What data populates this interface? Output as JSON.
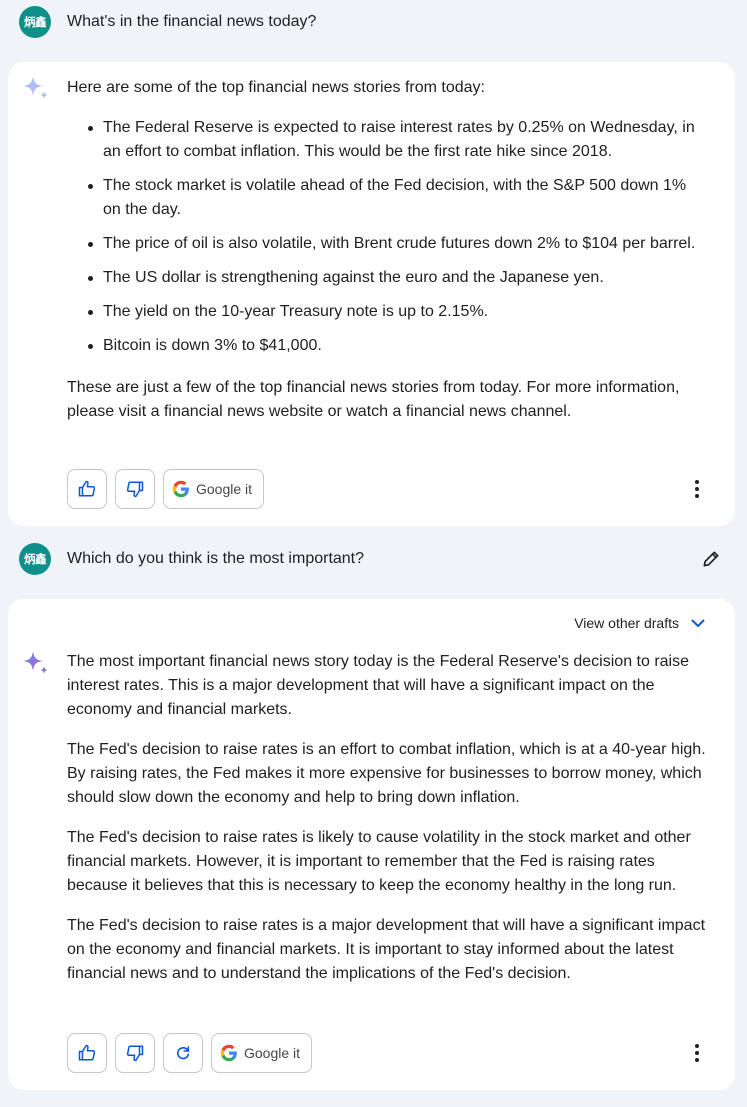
{
  "conversation": {
    "user_initials": "炳鑫",
    "turns": [
      {
        "prompt": "What's in the financial news today?",
        "response": {
          "intro": "Here are some of the top financial news stories from today:",
          "bullets": [
            "The Federal Reserve is expected to raise interest rates by 0.25% on Wednesday, in an effort to combat inflation. This would be the first rate hike since 2018.",
            "The stock market is volatile ahead of the Fed decision, with the S&P 500 down 1% on the day.",
            "The price of oil is also volatile, with Brent crude futures down 2% to $104 per barrel.",
            "The US dollar is strengthening against the euro and the Japanese yen.",
            "The yield on the 10-year Treasury note is up to 2.15%.",
            "Bitcoin is down 3% to $41,000."
          ],
          "outro": "These are just a few of the top financial news stories from today. For more information, please visit a financial news website or watch a financial news channel."
        }
      },
      {
        "prompt": "Which do you think is the most important?",
        "response": {
          "paragraphs": [
            "The most important financial news story today is the Federal Reserve's decision to raise interest rates. This is a major development that will have a significant impact on the economy and financial markets.",
            "The Fed's decision to raise rates is an effort to combat inflation, which is at a 40-year high. By raising rates, the Fed makes it more expensive for businesses to borrow money, which should slow down the economy and help to bring down inflation.",
            "The Fed's decision to raise rates is likely to cause volatility in the stock market and other financial markets. However, it is important to remember that the Fed is raising rates because it believes that this is necessary to keep the economy healthy in the long run.",
            "The Fed's decision to raise rates is a major development that will have a significant impact on the economy and financial markets. It is important to stay informed about the latest financial news and to understand the implications of the Fed's decision."
          ]
        }
      }
    ]
  },
  "actions": {
    "google_it_label": "Google it",
    "view_drafts_label": "View other drafts"
  },
  "icons": {
    "thumbs_up": "thumbs-up-icon",
    "thumbs_down": "thumbs-down-icon",
    "regenerate": "refresh-icon",
    "google": "google-g-icon",
    "more": "more-vert-icon",
    "edit": "pencil-icon",
    "assistant": "sparkle-icon"
  },
  "colors": {
    "avatar_bg": "#0e8f8a",
    "page_bg": "#f0f4f9",
    "card_bg": "#ffffff",
    "accent_blue": "#0b57d0"
  }
}
